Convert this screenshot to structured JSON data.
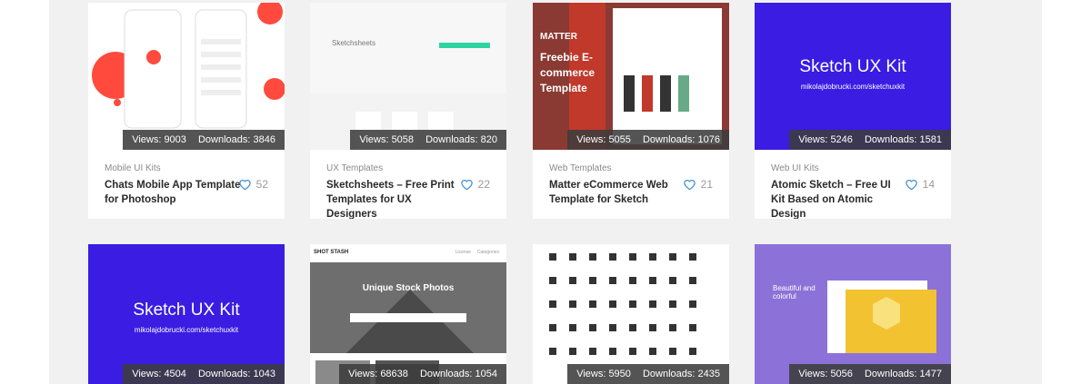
{
  "cards": [
    {
      "category": "Mobile UI Kits",
      "title": "Chats Mobile App Template for Photoshop",
      "likes": "52",
      "views": "Views: 9003",
      "downloads": "Downloads: 3846"
    },
    {
      "category": "UX Templates",
      "title": "Sketchsheets – Free Print Templates for UX Designers",
      "likes": "22",
      "views": "Views: 5058",
      "downloads": "Downloads: 820",
      "thumb_text": "Sketchsheets"
    },
    {
      "category": "Web Templates",
      "title": "Matter eCommerce Web Template for Sketch",
      "likes": "21",
      "views": "Views: 5055",
      "downloads": "Downloads: 1076",
      "thumb_brand": "MATTER",
      "thumb_text": "Freebie E-commerce Template"
    },
    {
      "category": "Web UI Kits",
      "title": "Atomic Sketch – Free UI Kit Based on Atomic Design",
      "likes": "14",
      "views": "Views: 5246",
      "downloads": "Downloads: 1581",
      "thumb_text": "Sketch UX Kit",
      "thumb_sub": "mikolajdobrucki.com/sketchuxkit"
    },
    {
      "views": "Views: 4504",
      "downloads": "Downloads: 1043",
      "thumb_text": "Sketch UX Kit",
      "thumb_sub": "mikolajdobrucki.com/sketchuxkit"
    },
    {
      "views": "Views: 68638",
      "downloads": "Downloads: 1054",
      "thumb_brand": "SHOT STASH",
      "thumb_text": "Unique Stock Photos",
      "thumb_nav": "License     Categories"
    },
    {
      "views": "Views: 5950",
      "downloads": "Downloads: 2435"
    },
    {
      "views": "Views: 5056",
      "downloads": "Downloads: 1477",
      "thumb_text": "Beautiful and colorful"
    }
  ]
}
